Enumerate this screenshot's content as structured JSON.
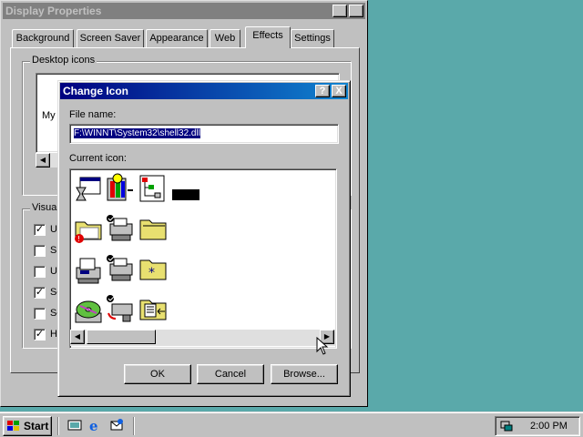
{
  "display_properties": {
    "title": "Display Properties",
    "tabs": [
      "Background",
      "Screen Saver",
      "Appearance",
      "Web",
      "Effects",
      "Settings"
    ],
    "active_tab": "Effects",
    "desktop_icons_group": "Desktop icons",
    "desktop_icon_partial_label": "My (",
    "visual_group_partial": "Visua",
    "visual_options": [
      {
        "label": "U",
        "checked": true
      },
      {
        "label": "Sı",
        "checked": false
      },
      {
        "label": "U",
        "checked": false
      },
      {
        "label": "Sł",
        "checked": true
      },
      {
        "label": "Sł",
        "checked": false
      },
      {
        "label": "H",
        "checked": true
      }
    ],
    "help_button": "?",
    "close_button": "X"
  },
  "change_icon": {
    "title": "Change Icon",
    "file_name_label": "File name:",
    "file_name_value": "F:\\WINNT\\System32\\shell32.dll",
    "current_icon_label": "Current icon:",
    "ok_button": "OK",
    "cancel_button": "Cancel",
    "browse_button": "Browse...",
    "help_button": "?",
    "close_button": "X",
    "icons": [
      "hourglass-window-icon",
      "control-panel-icon",
      "network-tree-icon",
      "black-rectangle-icon",
      "shared-folder-error-icon",
      "shared-printer-icon",
      "folder-open-icon",
      "fax-printer-icon",
      "shared-printer-2-icon",
      "folder-star-icon",
      "cd-drive-icon",
      "printer-network-icon",
      "folder-list-icon"
    ]
  },
  "taskbar": {
    "start_label": "Start",
    "clock": "2:00 PM",
    "quick_launch": [
      "show-desktop-icon",
      "internet-explorer-icon",
      "outlook-express-icon"
    ]
  },
  "colors": {
    "desktop": "#5aa9aa",
    "active_title": "#000080",
    "inactive_title": "#808080",
    "face": "#c0c0c0"
  }
}
